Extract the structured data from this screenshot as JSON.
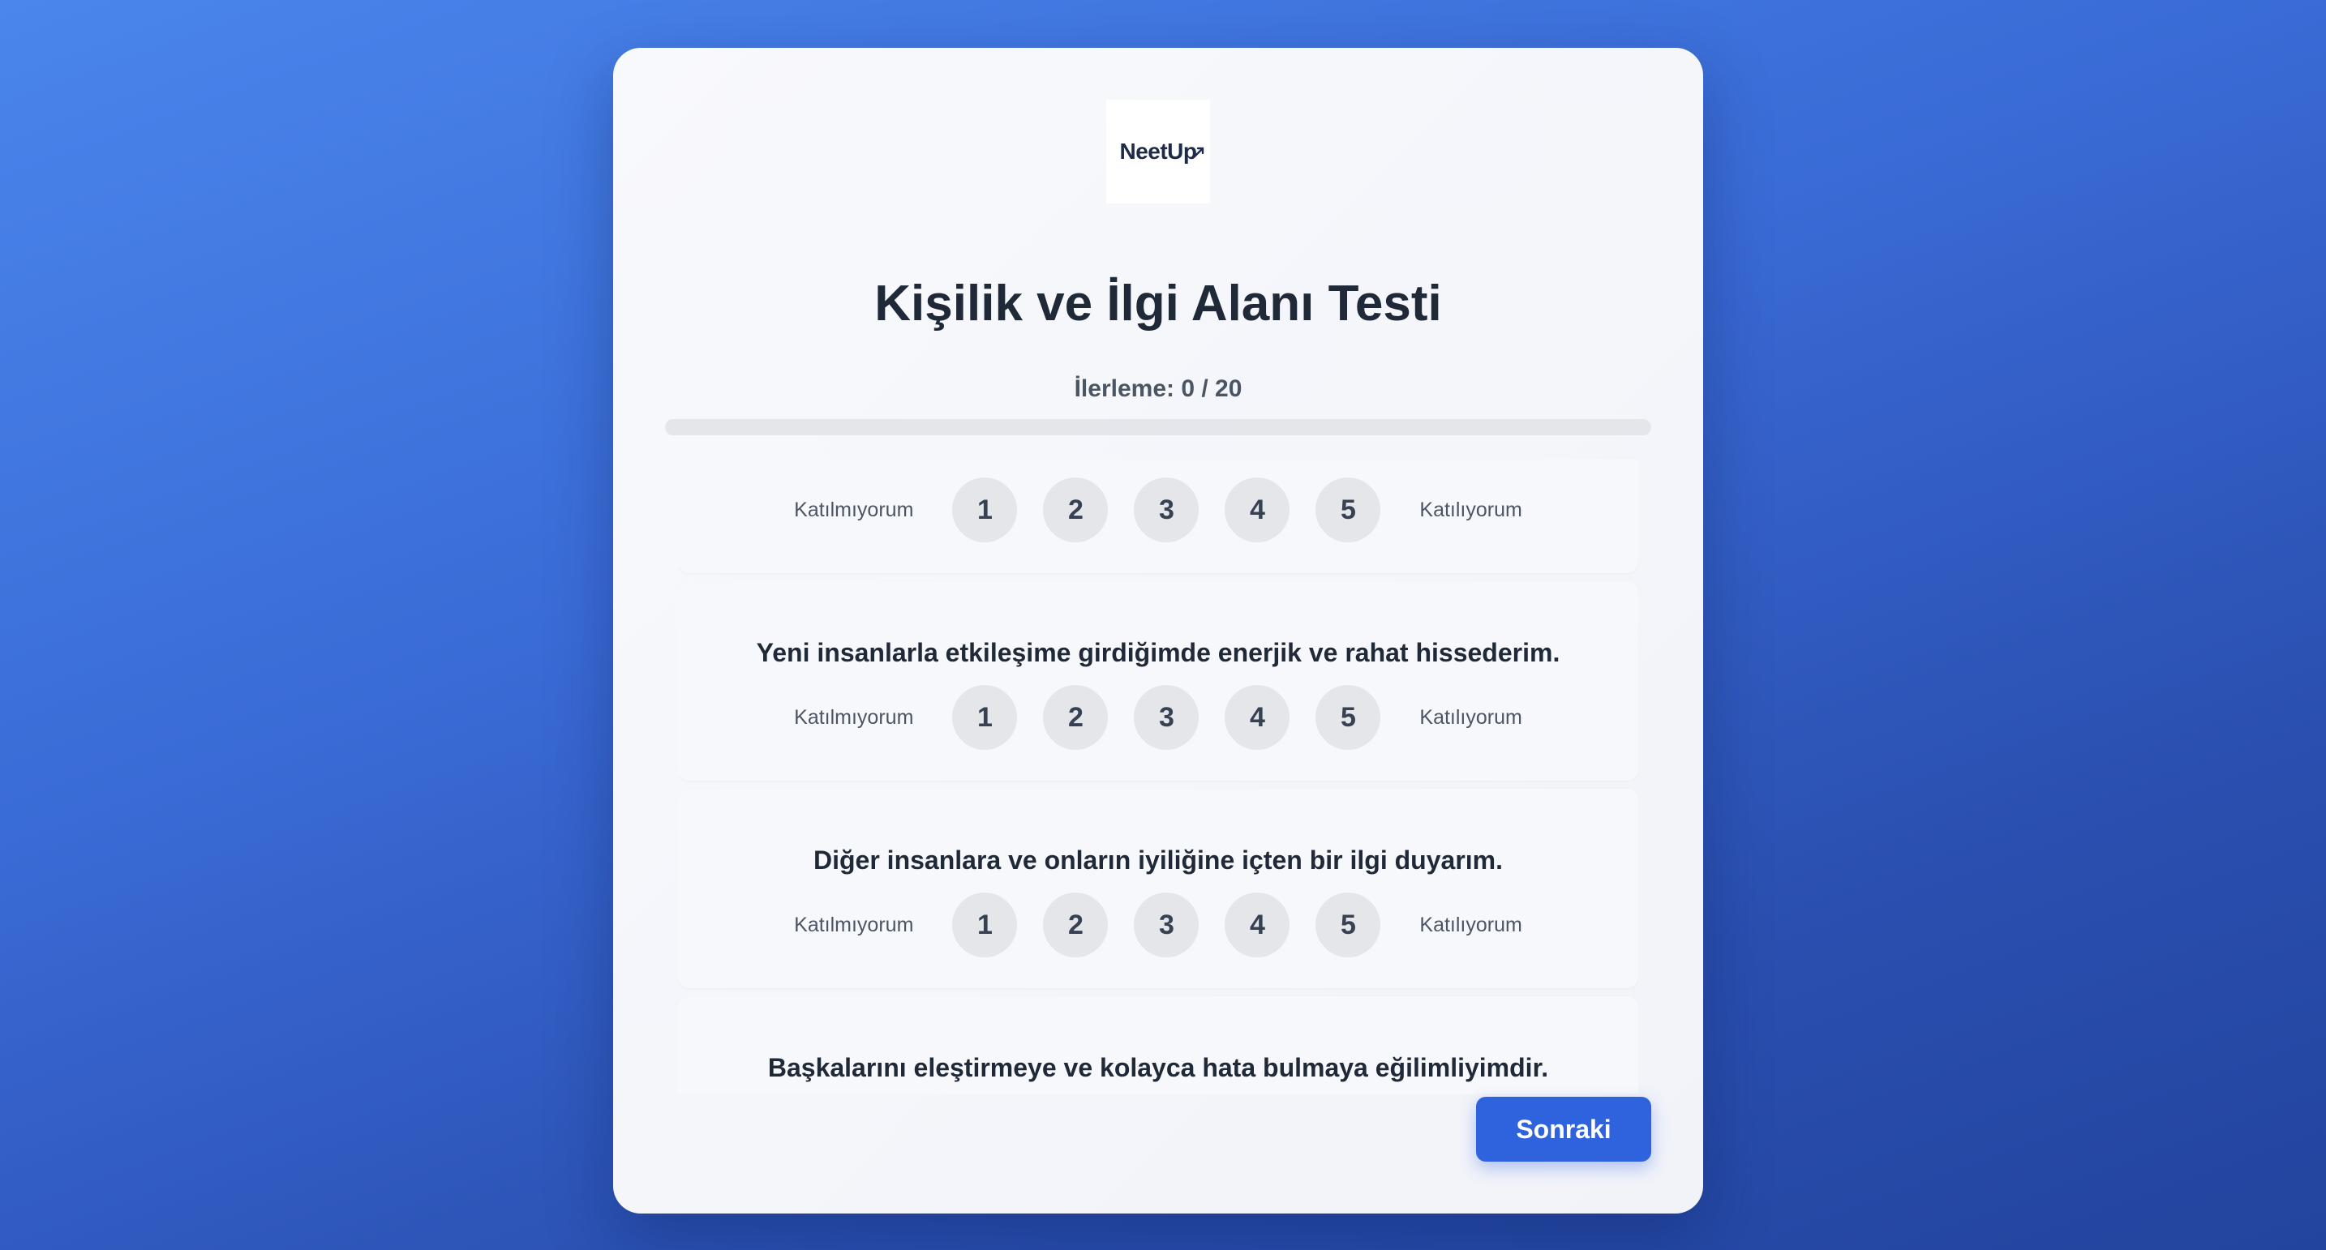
{
  "logo": {
    "text": "NeetUp"
  },
  "title": "Kişilik ve İlgi Alanı Testi",
  "progress": {
    "label": "İlerleme: 0 / 20",
    "fraction": 0
  },
  "scale": {
    "left_label": "Katılmıyorum",
    "right_label": "Katılıyorum",
    "options": [
      "1",
      "2",
      "3",
      "4",
      "5"
    ]
  },
  "questions": [
    {
      "text": ""
    },
    {
      "text": "Yeni insanlarla etkileşime girdiğimde enerjik ve rahat hissederim."
    },
    {
      "text": "Diğer insanlara ve onların iyiliğine içten bir ilgi duyarım."
    },
    {
      "text": "Başkalarını eleştirmeye ve kolayca hata bulmaya eğilimliyimdir."
    }
  ],
  "next_button": "Sonraki",
  "colors": {
    "accent": "#2f62dd",
    "background_top": "#4a86ec",
    "background_bottom": "#23449e"
  }
}
